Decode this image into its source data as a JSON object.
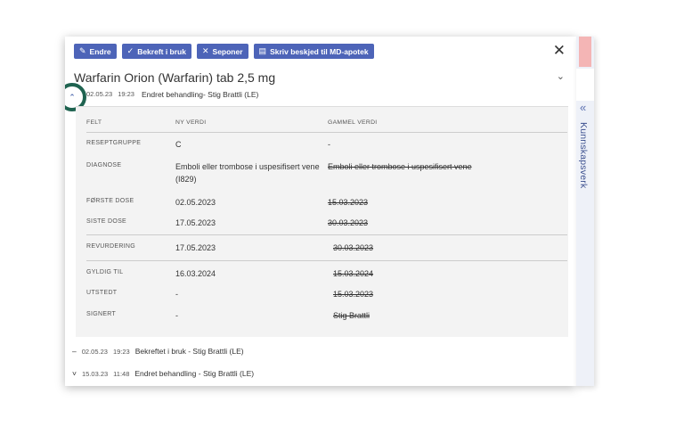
{
  "toolbar": {
    "edit_label": "Endre",
    "confirm_label": "Bekreft i bruk",
    "discontinue_label": "Seponer",
    "message_label": "Skriv beskjed til MD-apotek"
  },
  "title": "Warfarin Orion (Warfarin) tab 2,5 mg",
  "current_change": {
    "date": "02.05.23",
    "time": "19:23",
    "text": "Endret behandling- Stig Brattli (LE)"
  },
  "table": {
    "headers": {
      "field": "FELT",
      "new": "NY VERDI",
      "old": "GAMMEL VERDI"
    },
    "rows": [
      {
        "label": "RESEPTGRUPPE",
        "new": "C",
        "old": "-"
      },
      {
        "label": "DIAGNOSE",
        "new": "Emboli eller trombose i uspesifisert vene (I829)",
        "old": "Emboli eller trombose i uspesifisert vene"
      },
      {
        "label": "FØRSTE DOSE",
        "new": "02.05.2023",
        "old": "15.03.2023"
      },
      {
        "label": "SISTE DOSE",
        "new": "17.05.2023",
        "old": "30.03.2023"
      },
      {
        "label": "REVURDERING",
        "new": "17.05.2023",
        "old": "30.03.2023"
      },
      {
        "label": "GYLDIG TIL",
        "new": "16.03.2024",
        "old": "15.03.2024"
      },
      {
        "label": "UTSTEDT",
        "new": "-",
        "old": "15.03.2023"
      },
      {
        "label": "SIGNERT",
        "new": "-",
        "old": "Stig Brattli"
      }
    ]
  },
  "history": [
    {
      "marker": "–",
      "date": "02.05.23",
      "time": "19:23",
      "text": "Bekreftet i bruk - Stig Brattli (LE)"
    },
    {
      "marker": "˅",
      "date": "15.03.23",
      "time": "11:48",
      "text": "Endret behandling - Stig Brattli (LE)"
    }
  ],
  "side_panel": {
    "label": "Kunnskapsverk"
  },
  "colors": {
    "button_bg": "#4d64b8",
    "highlight_ring": "#1f6350",
    "side_bg": "#eef1f8"
  },
  "icons": {
    "edit": "pencil-icon",
    "confirm": "check-icon",
    "discontinue": "x-icon",
    "message": "message-icon",
    "close": "close-icon",
    "collapse": "chevron-up-double-icon",
    "sidebar": "chevron-left-double-icon"
  }
}
